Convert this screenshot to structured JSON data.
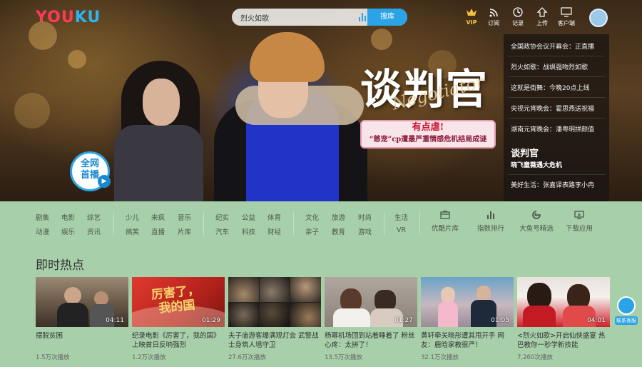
{
  "header": {
    "logo_left": "YOU",
    "logo_right": "KU",
    "search_value": "烈火如歌",
    "search_button": "搜库",
    "nav": [
      {
        "label": "VIP",
        "icon": "crown-icon"
      },
      {
        "label": "订阅",
        "icon": "rss-icon"
      },
      {
        "label": "记录",
        "icon": "clock-icon"
      },
      {
        "label": "上传",
        "icon": "upload-icon"
      },
      {
        "label": "客户端",
        "icon": "monitor-icon"
      }
    ]
  },
  "hero": {
    "title": "谈判官",
    "title_en": "Negotiator",
    "promo_line1": "有点虐!",
    "promo_line2": "“慈宠”cp遭最严重情感危机结局成谜",
    "live_badge_line1": "全网",
    "live_badge_line2": "首播"
  },
  "news_panel": {
    "items": [
      "全国政协会议开幕会：正直播",
      "烈火如歌：战飒强吻烈如歌",
      "这就是街舞：今晚20点上线",
      "央视元宵晚会：霍思燕送祝福",
      "湖南元宵晚会：潘粤明拼颜值"
    ],
    "featured_title": "谈判官",
    "featured_sub": "晓飞童薇遇大危机",
    "last_item": "美好生活：张嘉译表路李小冉"
  },
  "categories": {
    "groups": [
      {
        "row1": [
          "剧集",
          "电影",
          "综艺"
        ],
        "row2": [
          "动漫",
          "娱乐",
          "资讯"
        ]
      },
      {
        "row1": [
          "少儿",
          "来疯",
          "音乐"
        ],
        "row2": [
          "搞笑",
          "直播",
          "片库"
        ]
      },
      {
        "row1": [
          "纪实",
          "公益",
          "体育"
        ],
        "row2": [
          "汽车",
          "科技",
          "财经"
        ]
      },
      {
        "row1": [
          "文化",
          "旅游",
          "时尚"
        ],
        "row2": [
          "亲子",
          "教育",
          "游戏"
        ]
      },
      {
        "row1": [
          "生活"
        ],
        "row2": [
          "VR"
        ]
      }
    ],
    "tools": [
      {
        "label": "优酷片库",
        "icon": "film-library-icon"
      },
      {
        "label": "指数排行",
        "icon": "bar-chart-icon"
      },
      {
        "label": "大鱼号精选",
        "icon": "fish-icon"
      },
      {
        "label": "下载应用",
        "icon": "download-monitor-icon"
      }
    ]
  },
  "hot": {
    "section_title": "即时热点",
    "videos": [
      {
        "title": "摆脱贫困",
        "duration": "04:11",
        "views": "1.5万次播放",
        "bg": "#6b5a48"
      },
      {
        "title": "纪录电影《厉害了，我的国》上映首日反响强烈",
        "duration": "01:29",
        "views": "1.2万次播放",
        "bg": "#b3221c",
        "overlay": "厉害了，我的国"
      },
      {
        "title": "夫子庙游客爆满观灯会 武警战士身筑人墙守卫",
        "duration": "",
        "views": "27.6万次播放",
        "bg": "#3a3634"
      },
      {
        "title": "杨幂机场団到站着睡着了 粉丝心疼：太拼了！",
        "duration": "01:27",
        "views": "13.5万次播放",
        "bg": "#8a8078"
      },
      {
        "title": "黄轩牵关晓彤遭其甩开手 网友：鹿晗家教很严！",
        "duration": "01:05",
        "views": "32.1万次播放",
        "bg": "#c7b8c0"
      },
      {
        "title": "<烈火如歌>开启仙侠盛宴 热巴教你一秒学新技能",
        "duration": "04:01",
        "views": "7,260次播放",
        "bg": "#d21f2a"
      }
    ]
  },
  "support": {
    "label": "联系客服"
  }
}
